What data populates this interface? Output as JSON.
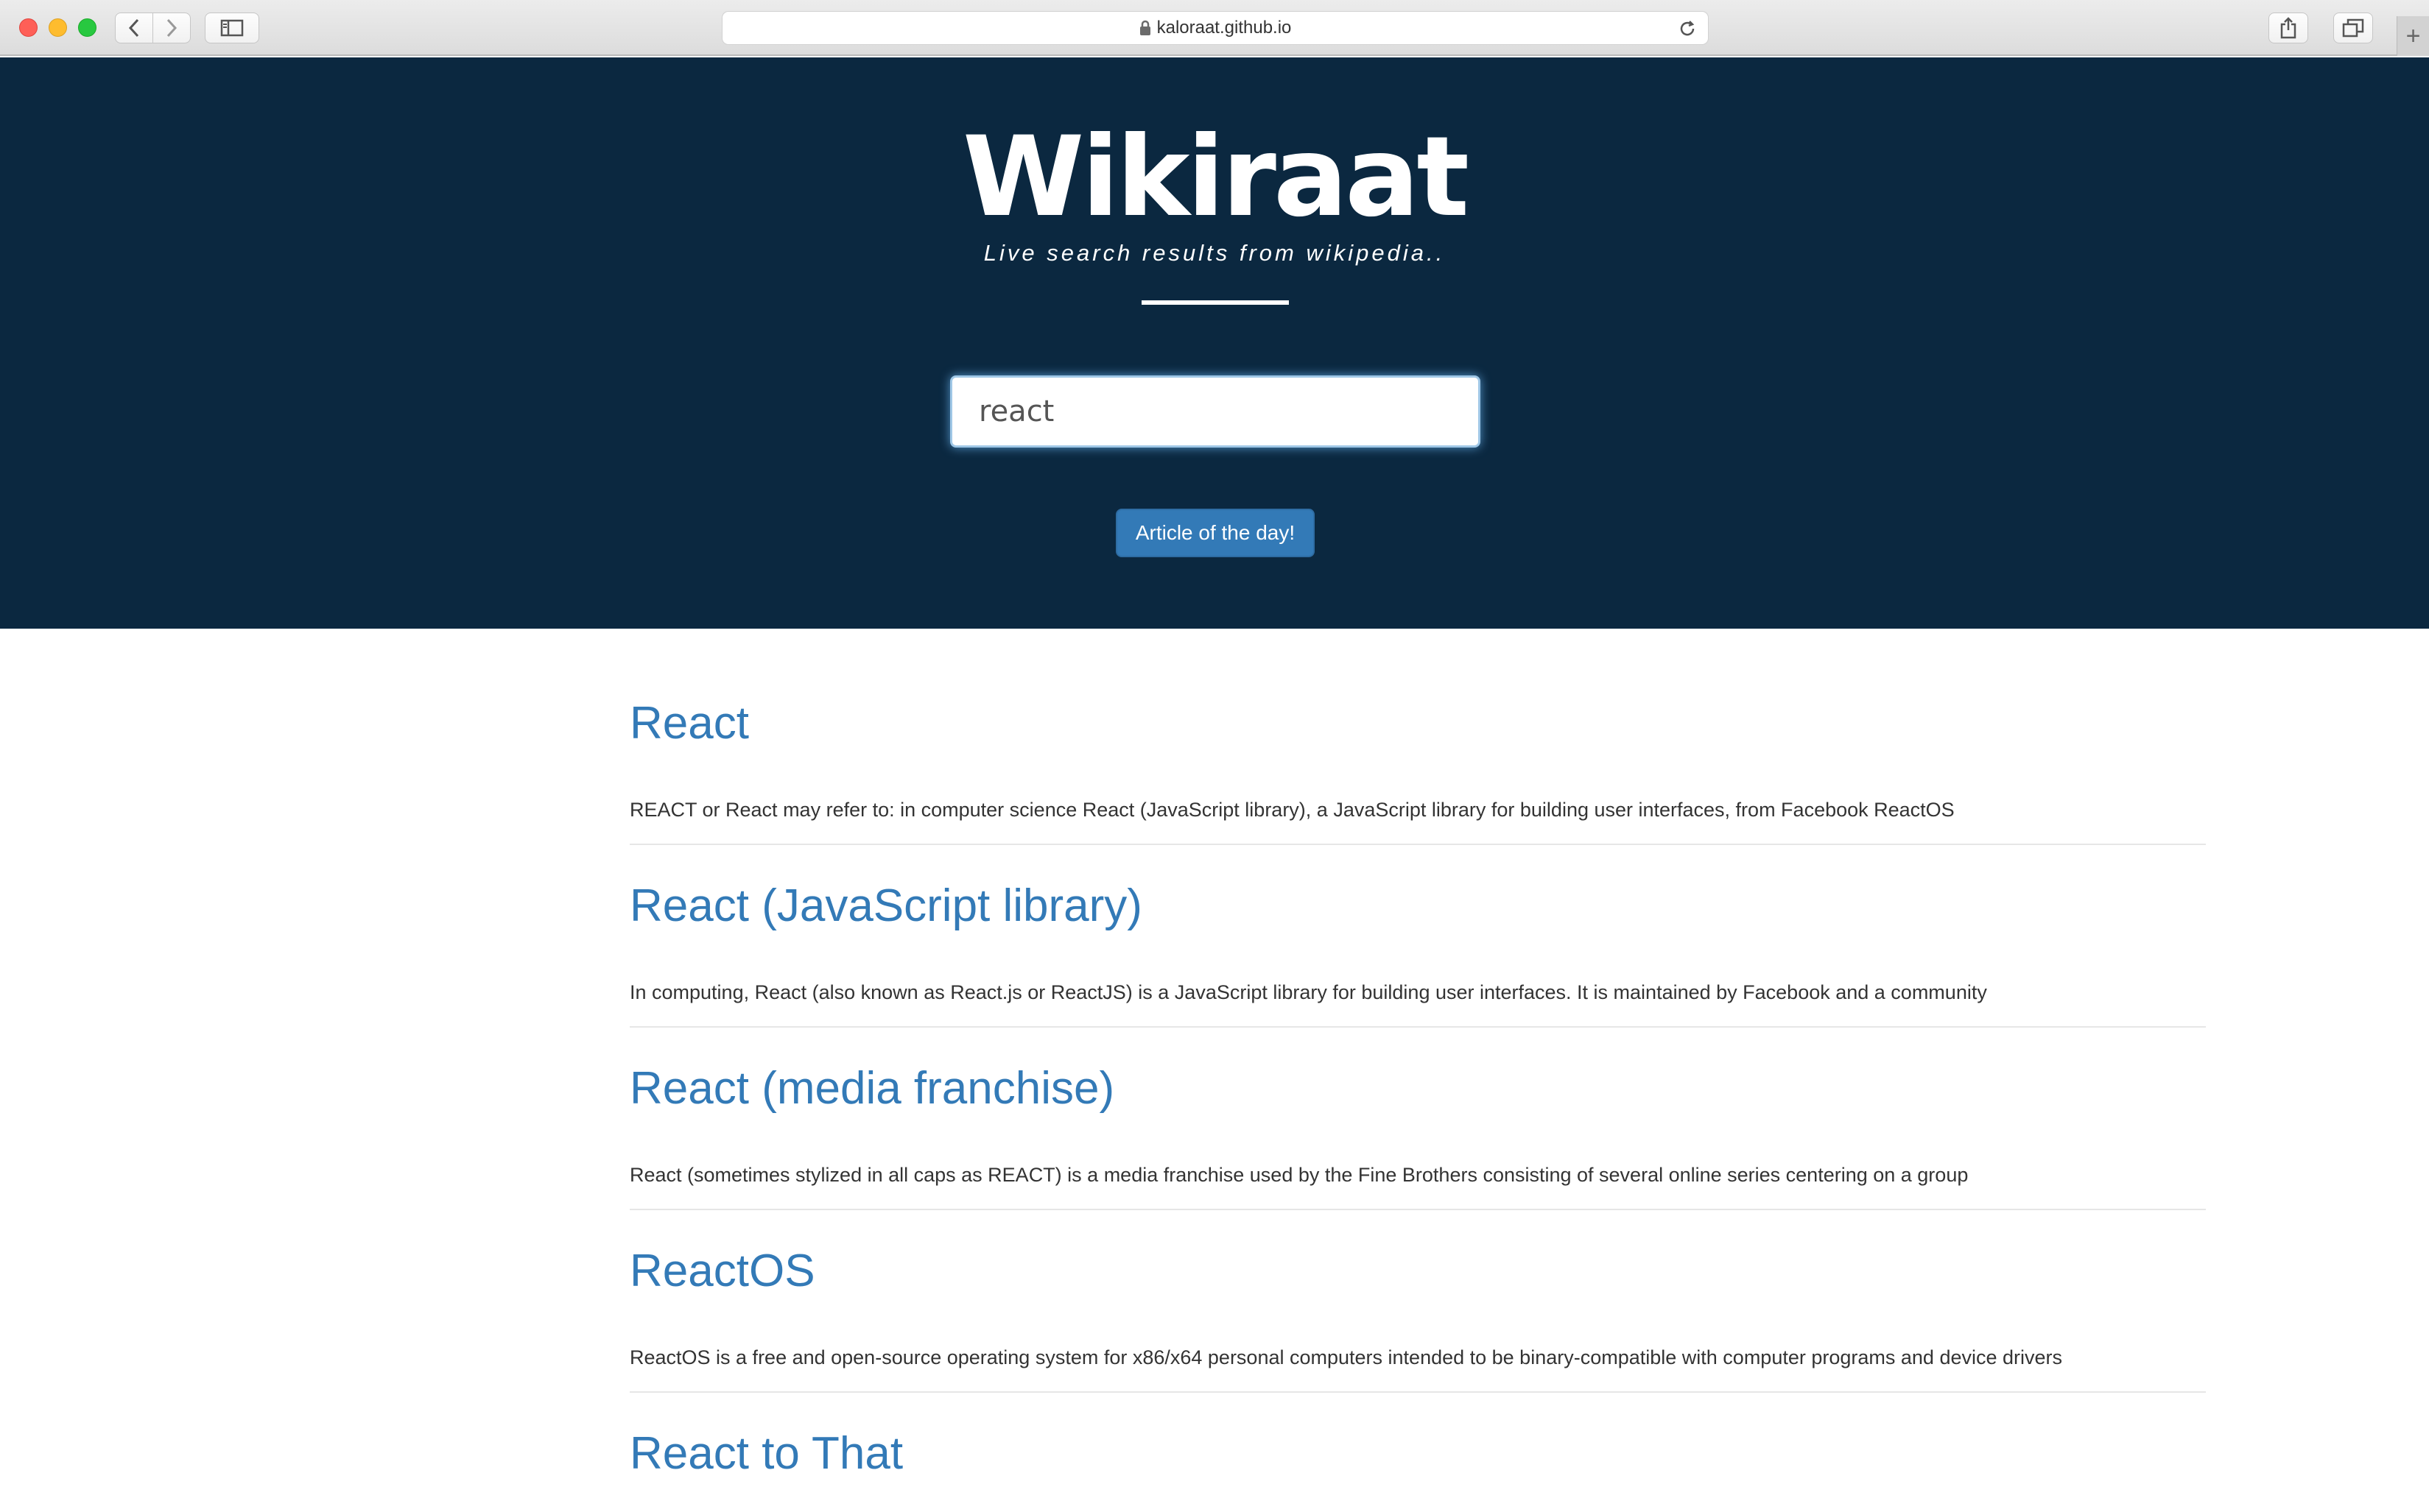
{
  "browser": {
    "url": "kaloraat.github.io",
    "new_tab_symbol": "+"
  },
  "hero": {
    "title": "Wikiraat",
    "tagline": "Live search results from wikipedia..",
    "search_value": "react",
    "article_button": "Article of the day!",
    "background_color": "#0b2840"
  },
  "results": [
    {
      "title": "React",
      "snippet": "REACT or React may refer to: in computer science React (JavaScript library), a JavaScript library for building user interfaces, from Facebook ReactOS"
    },
    {
      "title": "React (JavaScript library)",
      "snippet": "In computing, React (also known as React.js or ReactJS) is a JavaScript library for building user interfaces. It is maintained by Facebook and a community"
    },
    {
      "title": "React (media franchise)",
      "snippet": "React (sometimes stylized in all caps as REACT) is a media franchise used by the Fine Brothers consisting of several online series centering on a group"
    },
    {
      "title": "ReactOS",
      "snippet": "ReactOS is a free and open-source operating system for x86/x64 personal computers intended to be binary-compatible with computer programs and device drivers"
    },
    {
      "title": "React to That",
      "snippet": ""
    }
  ],
  "colors": {
    "link": "#337ab7",
    "button": "#337ab7"
  }
}
